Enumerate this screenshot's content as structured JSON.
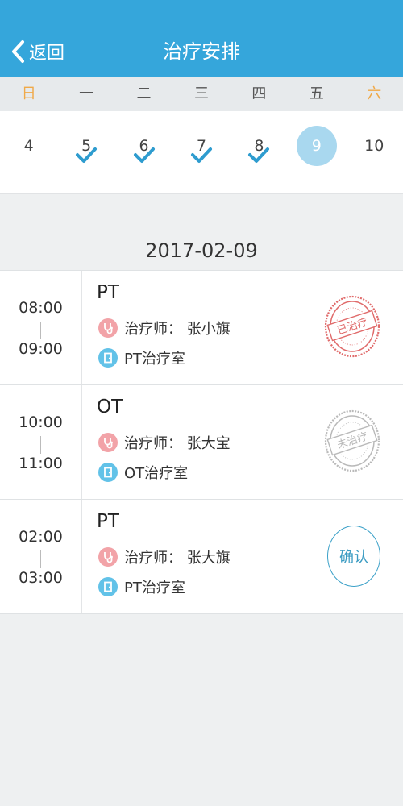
{
  "header": {
    "back_label": "返回",
    "title": "治疗安排"
  },
  "weekdays": [
    "日",
    "一",
    "二",
    "三",
    "四",
    "五",
    "六"
  ],
  "dates": [
    {
      "num": "4",
      "checked": false,
      "selected": false
    },
    {
      "num": "5",
      "checked": true,
      "selected": false
    },
    {
      "num": "6",
      "checked": true,
      "selected": false
    },
    {
      "num": "7",
      "checked": true,
      "selected": false
    },
    {
      "num": "8",
      "checked": true,
      "selected": false
    },
    {
      "num": "9",
      "checked": false,
      "selected": true
    },
    {
      "num": "10",
      "checked": false,
      "selected": false
    }
  ],
  "selected_date": "2017-02-09",
  "sessions": [
    {
      "start": "08:00",
      "end": "09:00",
      "type": "PT",
      "therapist": "治疗师：  张小旗",
      "room": "PT治疗室",
      "status": "done",
      "stamp_text": "已治疗"
    },
    {
      "start": "10:00",
      "end": "11:00",
      "type": "OT",
      "therapist": "治疗师：  张大宝",
      "room": "OT治疗室",
      "status": "pending",
      "stamp_text": "未治疗"
    },
    {
      "start": "02:00",
      "end": "03:00",
      "type": "PT",
      "therapist": "治疗师：  张大旗",
      "room": "PT治疗室",
      "status": "confirm",
      "confirm_label": "确认"
    }
  ],
  "colors": {
    "header": "#35a6db",
    "weekend": "#f0a948",
    "check": "#2e9ccf",
    "selected": "#a9d8ef",
    "stamp_done": "#e06a6a",
    "stamp_pending": "#b9b9b9"
  }
}
